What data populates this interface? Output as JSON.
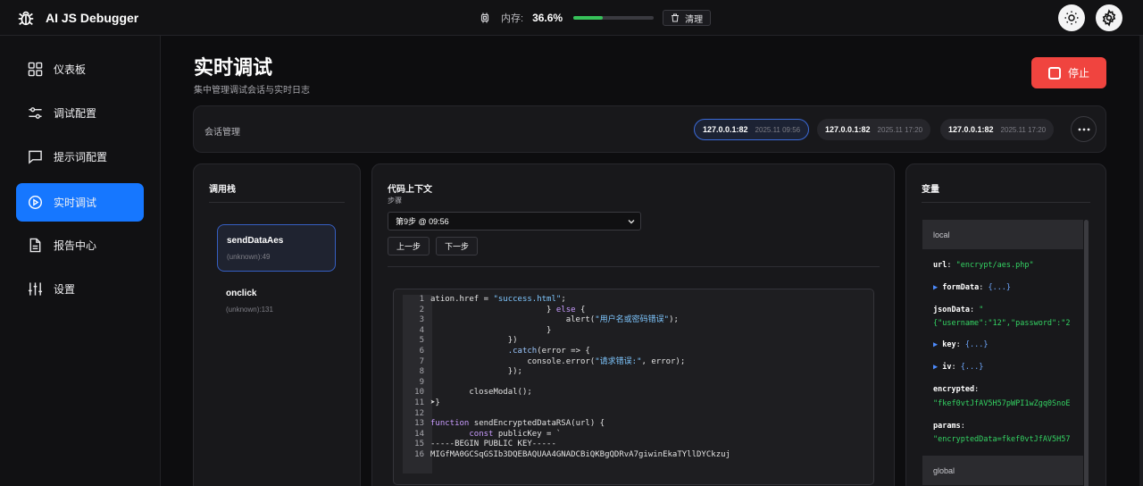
{
  "app": {
    "title": "AI JS Debugger",
    "memory_label": "内存:",
    "memory_value": "36.6%",
    "memory_fraction": 0.366,
    "clean_label": "清理",
    "icons": [
      "bug-icon",
      "chip-icon",
      "trash-icon",
      "sun-icon",
      "gear-icon"
    ]
  },
  "sidebar": {
    "items": [
      {
        "label": "仪表板",
        "icon": "dashboard-icon"
      },
      {
        "label": "调试配置",
        "icon": "sliders-icon"
      },
      {
        "label": "提示词配置",
        "icon": "message-icon"
      },
      {
        "label": "实时调试",
        "icon": "play-circle-icon",
        "active": true
      },
      {
        "label": "报告中心",
        "icon": "document-icon"
      },
      {
        "label": "设置",
        "icon": "equalizer-icon"
      }
    ]
  },
  "page": {
    "title": "实时调试",
    "subtitle": "集中管理调试会话与实时日志",
    "stop_label": "停止"
  },
  "sessions": {
    "label": "会话管理",
    "items": [
      {
        "ip": "127.0.0.1:82",
        "time": "2025.11 09:56",
        "active": true
      },
      {
        "ip": "127.0.0.1:82",
        "time": "2025.11 17:20"
      },
      {
        "ip": "127.0.0.1:82",
        "time": "2025.11 17:20"
      }
    ]
  },
  "callstack": {
    "title": "调用栈",
    "frames": [
      {
        "fn": "sendDataAes",
        "loc": "(unknown):49",
        "active": true
      },
      {
        "fn": "onclick",
        "loc": "(unknown):131"
      }
    ]
  },
  "code": {
    "title": "代码上下文",
    "step_label": "步骤",
    "selected_step": "第9步 @ 09:56",
    "prev_label": "上一步",
    "next_label": "下一步",
    "lines": [
      {
        "n": "1",
        "text": "ation.href = \"success.html\";"
      },
      {
        "n": "2",
        "text": "                        } else {"
      },
      {
        "n": "3",
        "text": "                            alert(\"用户名或密码错误\");"
      },
      {
        "n": "4",
        "text": "                        }"
      },
      {
        "n": "5",
        "text": "                })"
      },
      {
        "n": "6",
        "text": "                .catch(error => {"
      },
      {
        "n": "7",
        "text": "                    console.error(\"请求错误:\", error);"
      },
      {
        "n": "8",
        "text": "                });"
      },
      {
        "n": "9",
        "text": ""
      },
      {
        "n": "10",
        "text": "        closeModal();"
      },
      {
        "n": "11",
        "text": "➤}"
      },
      {
        "n": "12",
        "text": ""
      },
      {
        "n": "13",
        "text": "function sendEncryptedDataRSA(url) {"
      },
      {
        "n": "14",
        "text": "        const publicKey = `"
      },
      {
        "n": "15",
        "text": "-----BEGIN PUBLIC KEY-----"
      },
      {
        "n": "16",
        "text": "MIGfMA0GCSqGSIb3DQEBAQUAA4GNADCBiQKBgQDRvA7giwinEkaTYllDYCkzuj"
      }
    ]
  },
  "variables": {
    "title": "变量",
    "local_label": "local",
    "global_label": "global",
    "url_key": "url",
    "url_val": "\"encrypt/aes.php\"",
    "formdata_key": "formData",
    "formdata_val": "{...}",
    "jsondata_key": "jsonData",
    "jsondata_val1": "\"",
    "jsondata_val2": "{\"username\":\"12\",\"password\":\"2",
    "key_key": "key",
    "key_val": "{...}",
    "iv_key": "iv",
    "iv_val": "{...}",
    "encrypted_key": "encrypted",
    "encrypted_val": "\"fkef0vtJfAV5H57pWPI1wZgq0SnoE",
    "params_key": "params",
    "params_val": "\"encryptedData=fkef0vtJfAV5H57"
  }
}
